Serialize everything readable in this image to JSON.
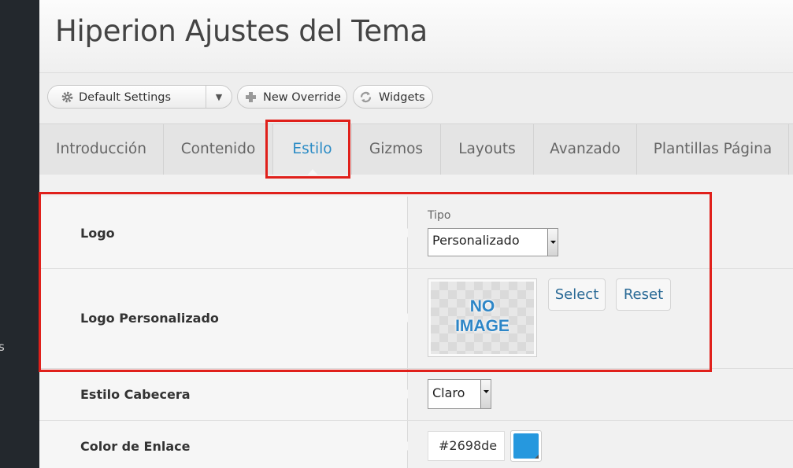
{
  "sidebar": {
    "visible_letter": "s"
  },
  "header": {
    "title": "Hiperion Ajustes del Tema"
  },
  "toolbar": {
    "settings_select": {
      "label": "Default Settings",
      "icon": "gear-icon"
    },
    "new_override": {
      "label": "New Override",
      "icon": "plus-icon"
    },
    "widgets": {
      "label": "Widgets",
      "icon": "refresh-icon"
    }
  },
  "tabs": [
    {
      "label": "Introducción"
    },
    {
      "label": "Contenido"
    },
    {
      "label": "Estilo",
      "active": true
    },
    {
      "label": "Gizmos"
    },
    {
      "label": "Layouts"
    },
    {
      "label": "Avanzado"
    },
    {
      "label": "Plantillas Página"
    }
  ],
  "settings": {
    "logo": {
      "label": "Logo",
      "sublabel": "Tipo",
      "value": "Personalizado"
    },
    "custom_logo": {
      "label": "Logo Personalizado",
      "placeholder_text": "NO\nIMAGE",
      "select_label": "Select",
      "reset_label": "Reset"
    },
    "header_style": {
      "label": "Estilo Cabecera",
      "value": "Claro"
    },
    "link_color": {
      "label": "Color de Enlace",
      "value": "#2698de",
      "swatch_color": "#2698de"
    }
  },
  "colors": {
    "accent": "#2a8bc5",
    "highlight_box": "#e0201b",
    "admin_bar": "#23282d"
  }
}
